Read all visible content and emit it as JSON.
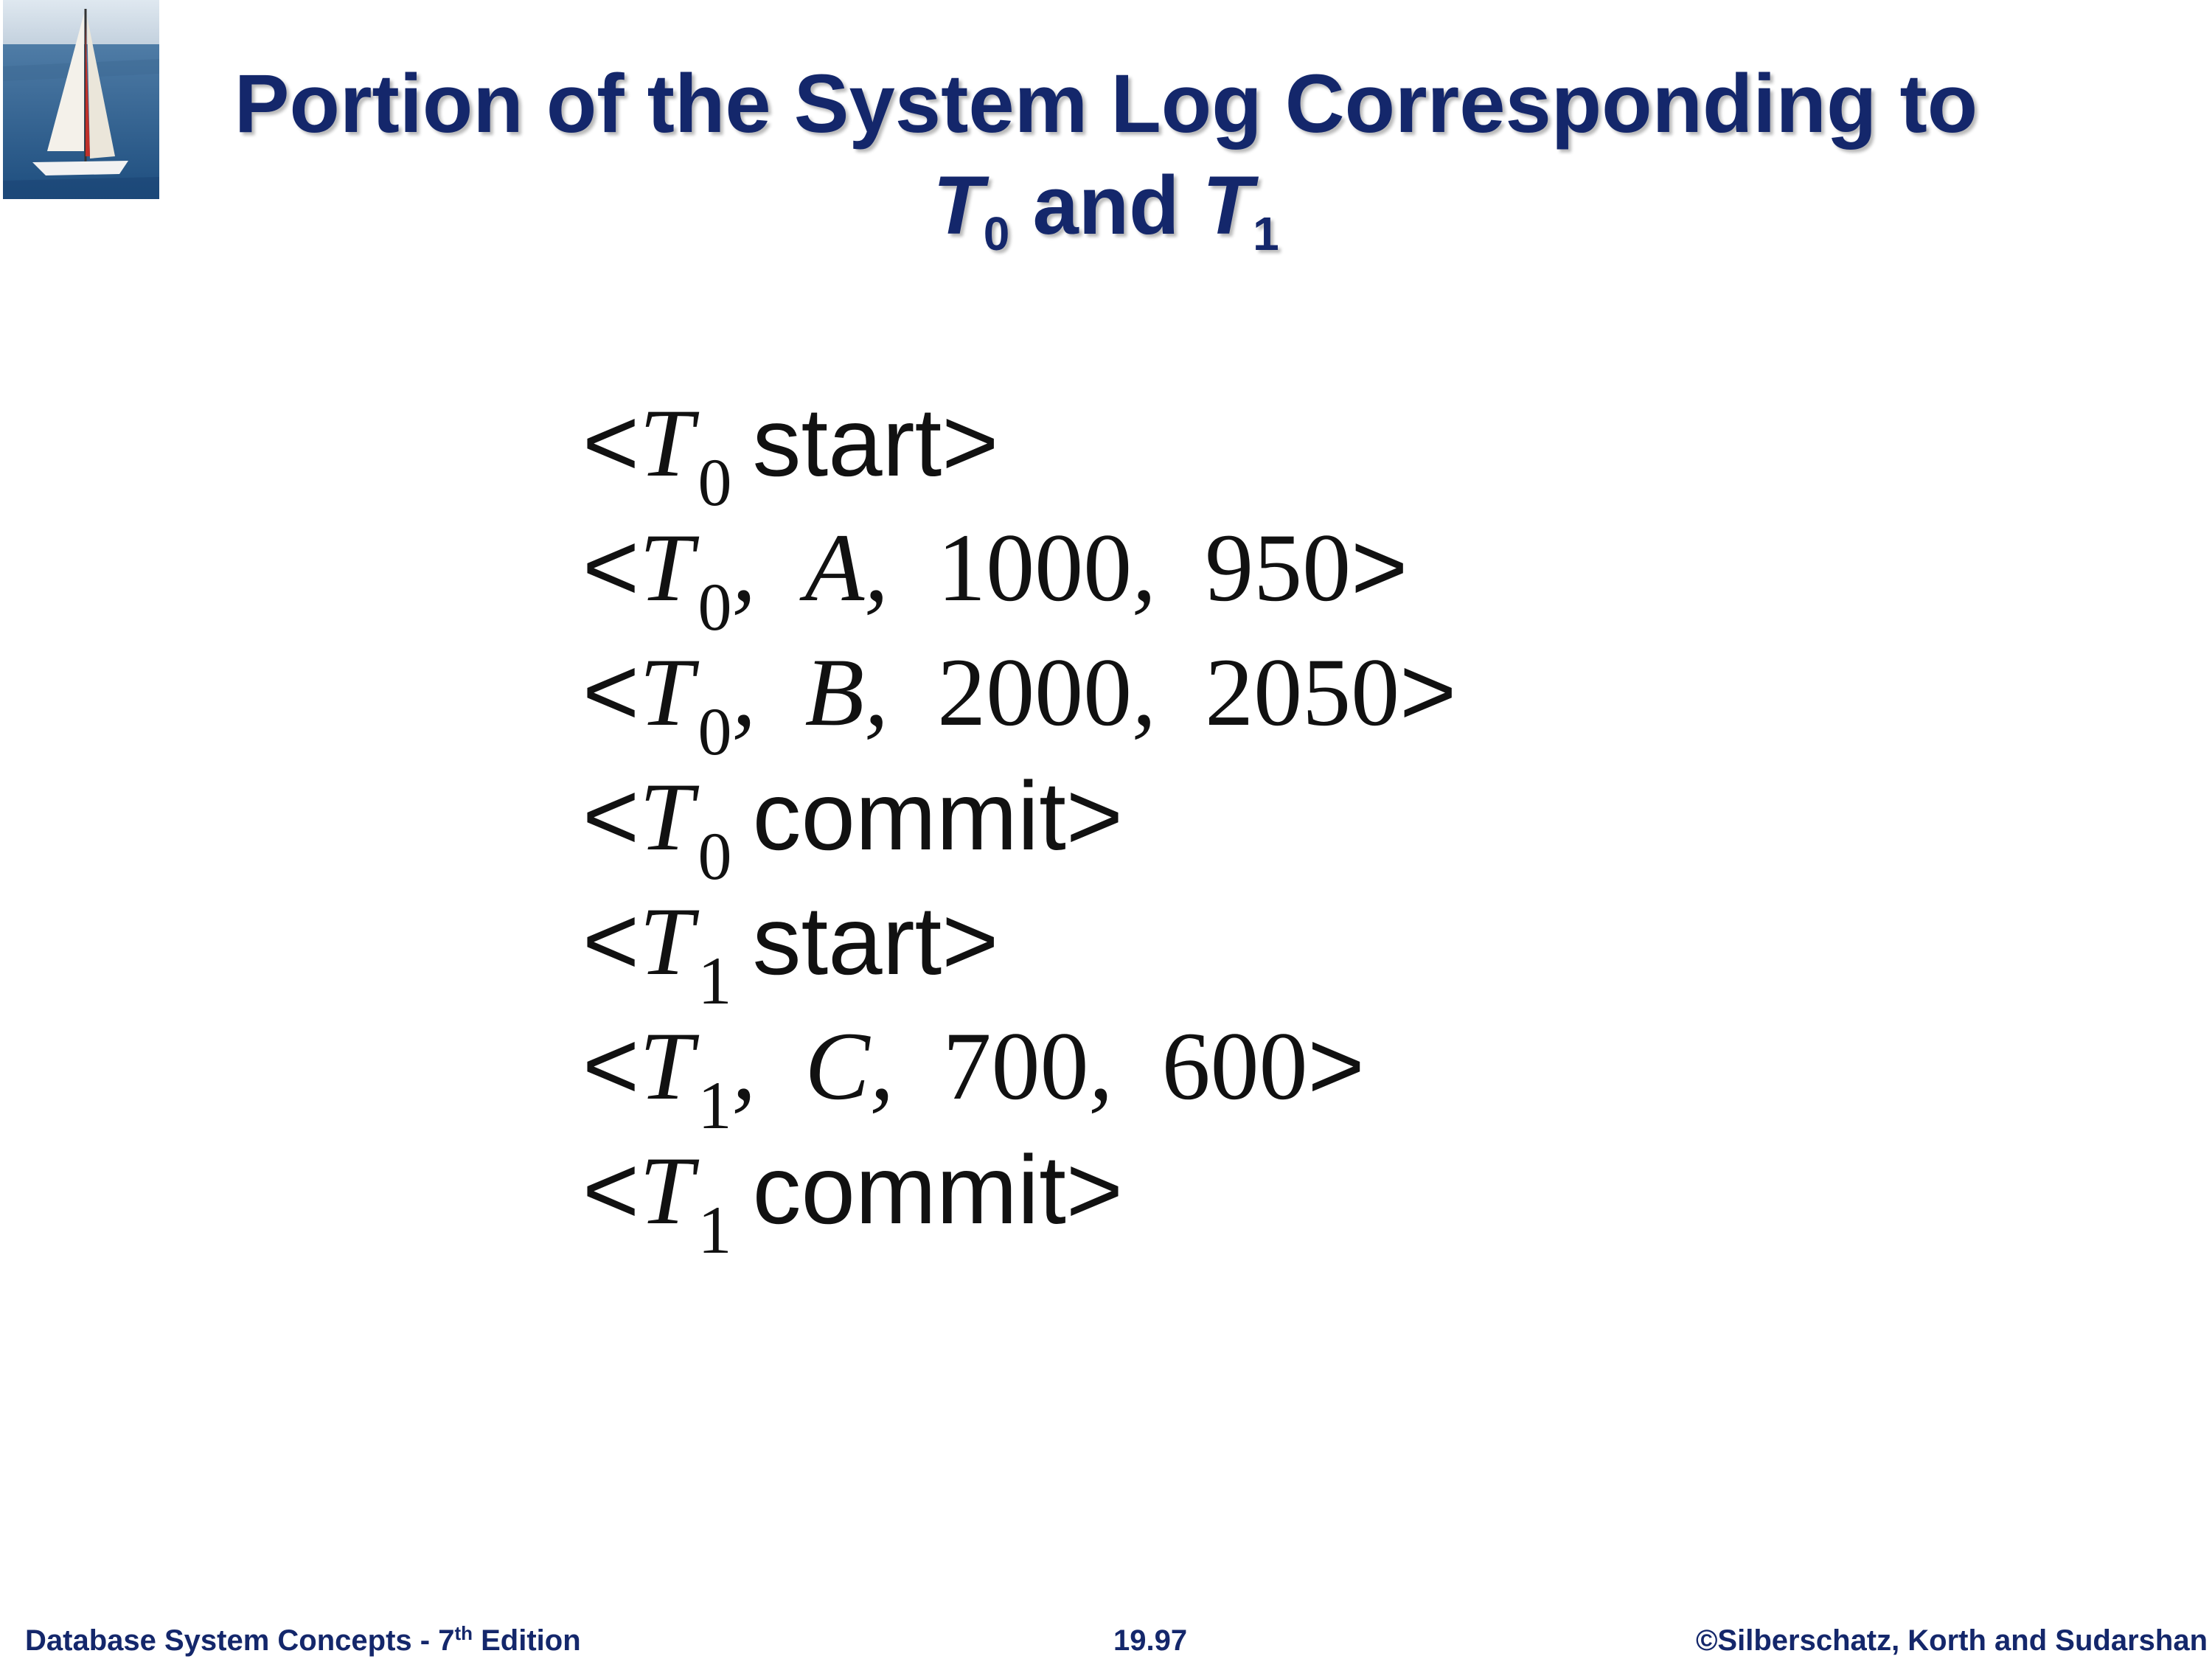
{
  "title": {
    "line1": "Portion of the System Log Corresponding to",
    "t0": "T",
    "t0_sub": "0",
    "and": "and",
    "t1": "T",
    "t1_sub": "1"
  },
  "log_entries": [
    {
      "open": "<",
      "txn": "T",
      "sub": "0",
      "text": "start",
      "close": ">"
    },
    {
      "open": "<",
      "txn": "T",
      "sub": "0",
      "item": "A",
      "old": "1000",
      "new": "950",
      "close": ">"
    },
    {
      "open": "<",
      "txn": "T",
      "sub": "0",
      "item": "B",
      "old": "2000",
      "new": "2050",
      "close": ">"
    },
    {
      "open": "<",
      "txn": "T",
      "sub": "0",
      "text": "commit",
      "close": ">"
    },
    {
      "open": "<",
      "txn": "T",
      "sub": "1",
      "text": "start",
      "close": ">"
    },
    {
      "open": "<",
      "txn": "T",
      "sub": "1",
      "item": "C",
      "old": "700",
      "new": "600",
      "close": ">"
    },
    {
      "open": "<",
      "txn": "T",
      "sub": "1",
      "text": "commit",
      "close": ">"
    }
  ],
  "footer": {
    "left": "Database System Concepts - 7",
    "left_sup": "th",
    "left_end": " Edition",
    "center": "19.97",
    "right": "©Silberschatz, Korth and Sudarshan"
  },
  "logo": {
    "icon": "sailboat-icon"
  }
}
